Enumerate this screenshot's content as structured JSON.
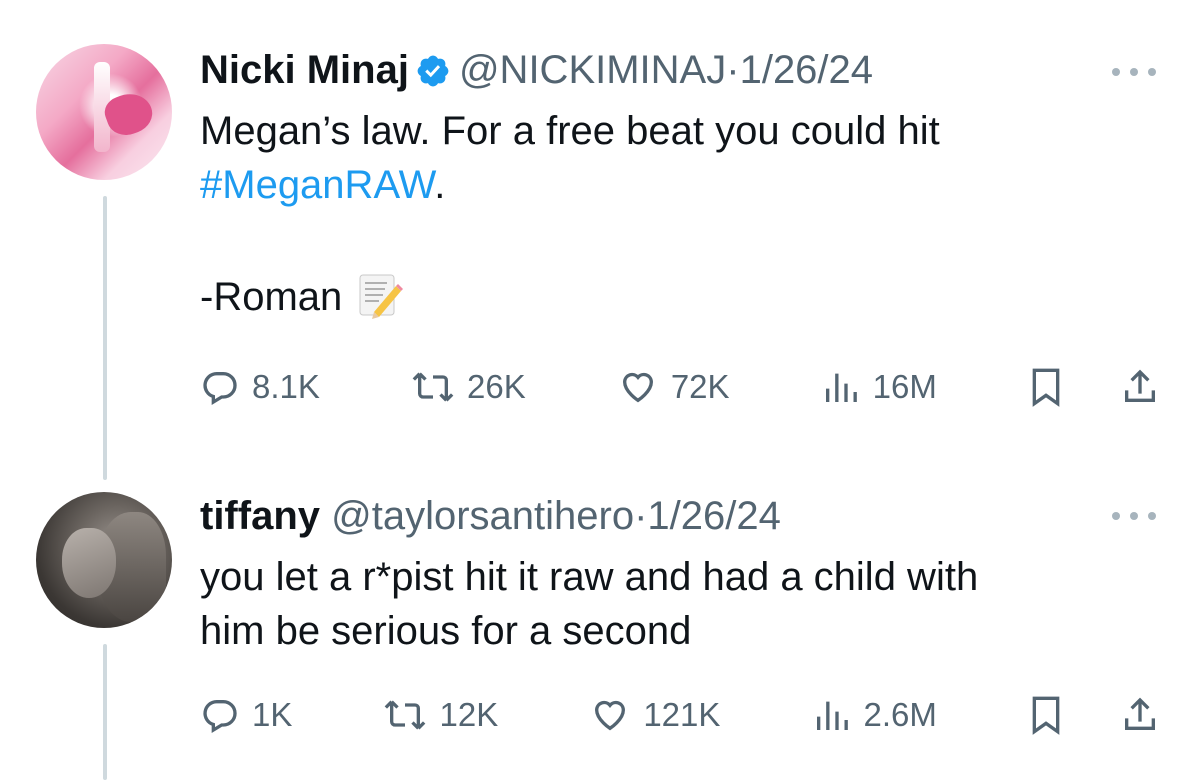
{
  "tweets": [
    {
      "name": "Nicki Minaj",
      "handle": "@NICKIMINAJ",
      "separator": "·",
      "date": "1/26/24",
      "text_line1": "Megan’s law. For a free beat you could hit",
      "hashtag": "#MeganRAW",
      "text_after_hashtag": ".",
      "signature": "-Roman",
      "emoji": "memo-icon",
      "verified": true,
      "stats": {
        "replies": "8.1K",
        "retweets": "26K",
        "likes": "72K",
        "views": "16M"
      }
    },
    {
      "name": "tiffany",
      "handle": "@taylorsantihero",
      "separator": "·",
      "date": "1/26/24",
      "text_line1": "you let a r*pist hit it raw and had a child with",
      "text_line2": "him be serious for a second",
      "verified": false,
      "stats": {
        "replies": "1K",
        "retweets": "12K",
        "likes": "121K",
        "views": "2.6M"
      }
    }
  ],
  "colors": {
    "text": "#0f1419",
    "muted": "#536471",
    "link": "#1d9bf0",
    "verified": "#1d9bf0",
    "thread_line": "#cfd9de"
  }
}
